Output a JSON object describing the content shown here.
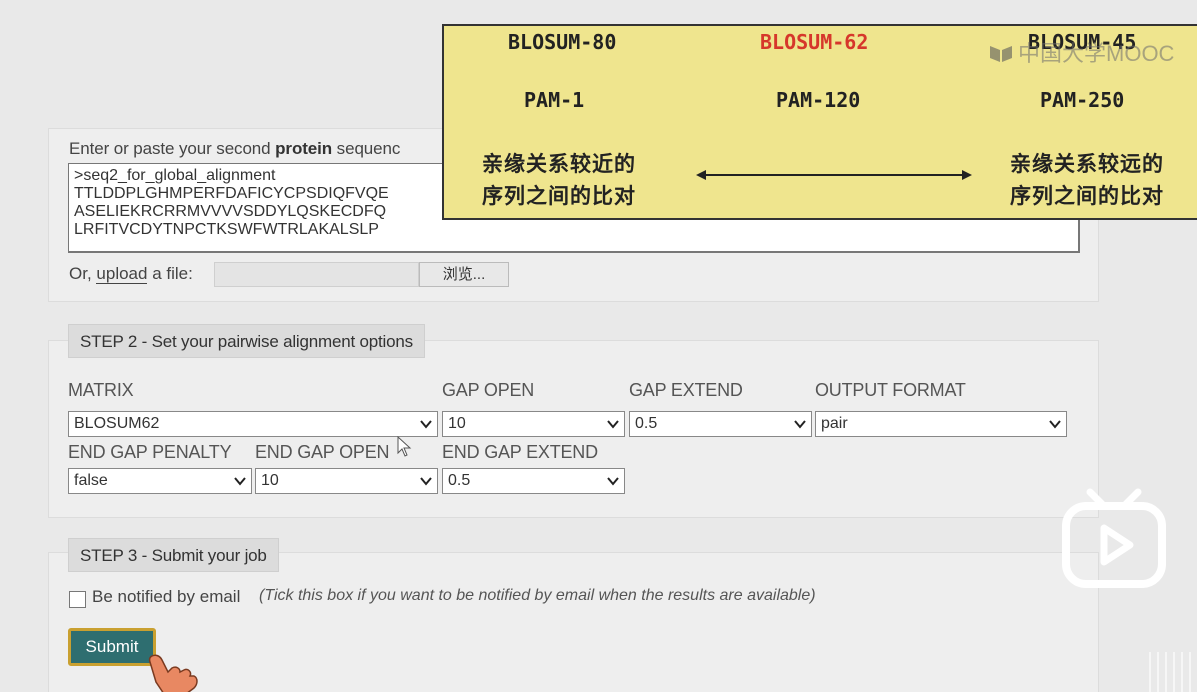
{
  "step1": {
    "seq_label_prefix": "Enter or paste  your second ",
    "seq_label_bold": "protein",
    "seq_label_suffix": " sequenc",
    "sequence": ">seq2_for_global_alignment\nTTLDDPLGHMPERFDAFICYCPSDIQFVQE\nASELIEKRCRRMVVVVSDDYLQSKECDFQ\nLRFITVCDYTNPCTKSWFWTRLAKALSLP",
    "upload_prefix": "Or, ",
    "upload_link": "upload",
    "upload_suffix": " a file:",
    "browse_label": "浏览..."
  },
  "step2": {
    "title": "STEP 2 - Set your pairwise alignment options",
    "matrix": {
      "label": "MATRIX",
      "value": "BLOSUM62"
    },
    "gap_open": {
      "label": "GAP OPEN",
      "value": "10"
    },
    "gap_extend": {
      "label": "GAP EXTEND",
      "value": "0.5"
    },
    "output_format": {
      "label": "OUTPUT FORMAT",
      "value": "pair"
    },
    "end_gap_penalty": {
      "label": "END GAP PENALTY",
      "value": "false"
    },
    "end_gap_open": {
      "label": "END GAP OPEN",
      "value": "10"
    },
    "end_gap_extend": {
      "label": "END GAP EXTEND",
      "value": "0.5"
    }
  },
  "step3": {
    "title": "STEP 3 - Submit your job",
    "notify_label": "Be notified by email",
    "notify_hint": "(Tick this box if you want to be notified by email when the results are available)",
    "submit_label": "Submit"
  },
  "slide": {
    "row1": [
      "BLOSUM-80",
      "BLOSUM-62",
      "BLOSUM-45"
    ],
    "row2": [
      "PAM-1",
      "PAM-120",
      "PAM-250"
    ],
    "left_note": [
      "亲缘关系较近的",
      "序列之间的比对"
    ],
    "right_note": [
      "亲缘关系较远的",
      "序列之间的比对"
    ],
    "highlight_color": "#d6372b"
  },
  "watermark": "中国大学MOOC",
  "colors": {
    "submit_bg": "#2e6e70",
    "submit_border": "#c9a030",
    "slide_bg": "#efe58e"
  }
}
